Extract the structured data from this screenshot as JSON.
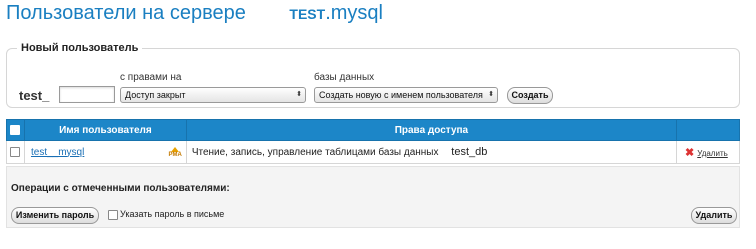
{
  "title": {
    "text": "Пользователи на сервере",
    "server_name": "test",
    "server_suffix": ".mysql"
  },
  "new_user": {
    "legend": "Новый пользователь",
    "prefix": "test_",
    "username_value": "",
    "rights_label": "с правами на",
    "rights_select": "Доступ закрыт",
    "db_label": "базы данных",
    "db_select": "Создать новую с именем пользователя",
    "create_button": "Создать"
  },
  "table": {
    "headers": [
      "Имя пользователя",
      "Права доступа"
    ],
    "rows": [
      {
        "username": "test__mysql",
        "rights": "Чтение, запись, управление таблицами базы данных",
        "database": "test_db",
        "delete_label": "Удалить",
        "pma_label": "PMA"
      }
    ]
  },
  "operations": {
    "title": "Операции с отмеченными пользователями:",
    "change_password_button": "Изменить пароль",
    "email_password_label": "Указать пароль в письме",
    "delete_button": "Удалить"
  },
  "colors": {
    "accent": "#1c86c8",
    "title": "#1a7fc1",
    "link": "#1a6fb5",
    "delete_x": "#dd3333"
  }
}
